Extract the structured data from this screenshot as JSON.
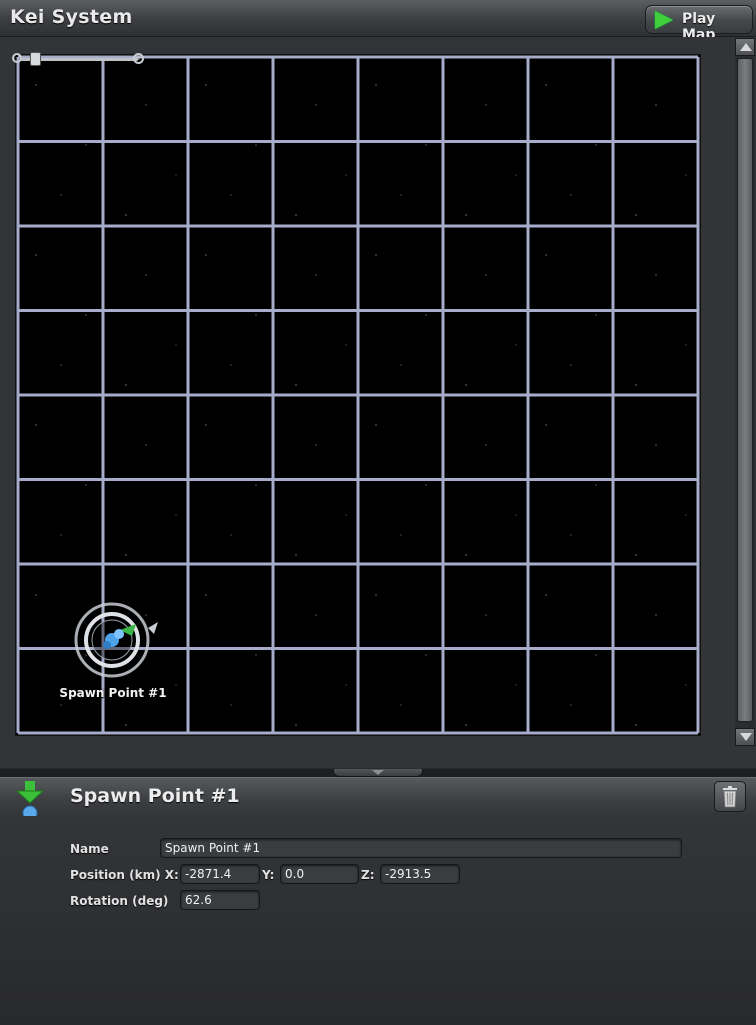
{
  "app": {
    "title": "Kei System"
  },
  "toolbar": {
    "play_label": "Play Map",
    "play_icon": "play-icon",
    "play_color": "#3fcf3a"
  },
  "map": {
    "grid": {
      "columns": 8,
      "rows": 8,
      "line_color": "#a6acc9",
      "background": "#000000"
    },
    "zoom": {
      "zoom_out_icon": "zoom-out-icon",
      "zoom_in_icon": "zoom-in-icon",
      "level": 0.1
    },
    "spawn_point": {
      "label": "Spawn Point #1",
      "icon": "spawn-point-icon"
    }
  },
  "inspector": {
    "title": "Spawn Point #1",
    "entity_icon": "spawn-entity-icon",
    "delete_icon": "trash-icon",
    "fields": {
      "name_label": "Name",
      "name_value": "Spawn Point #1",
      "position_label": "Position (km) X:",
      "x_value": "-2871.4",
      "y_label": "Y:",
      "y_value": "0.0",
      "z_label": "Z:",
      "z_value": "-2913.5",
      "rotation_label": "Rotation (deg)",
      "rotation_value": "62.6"
    }
  }
}
